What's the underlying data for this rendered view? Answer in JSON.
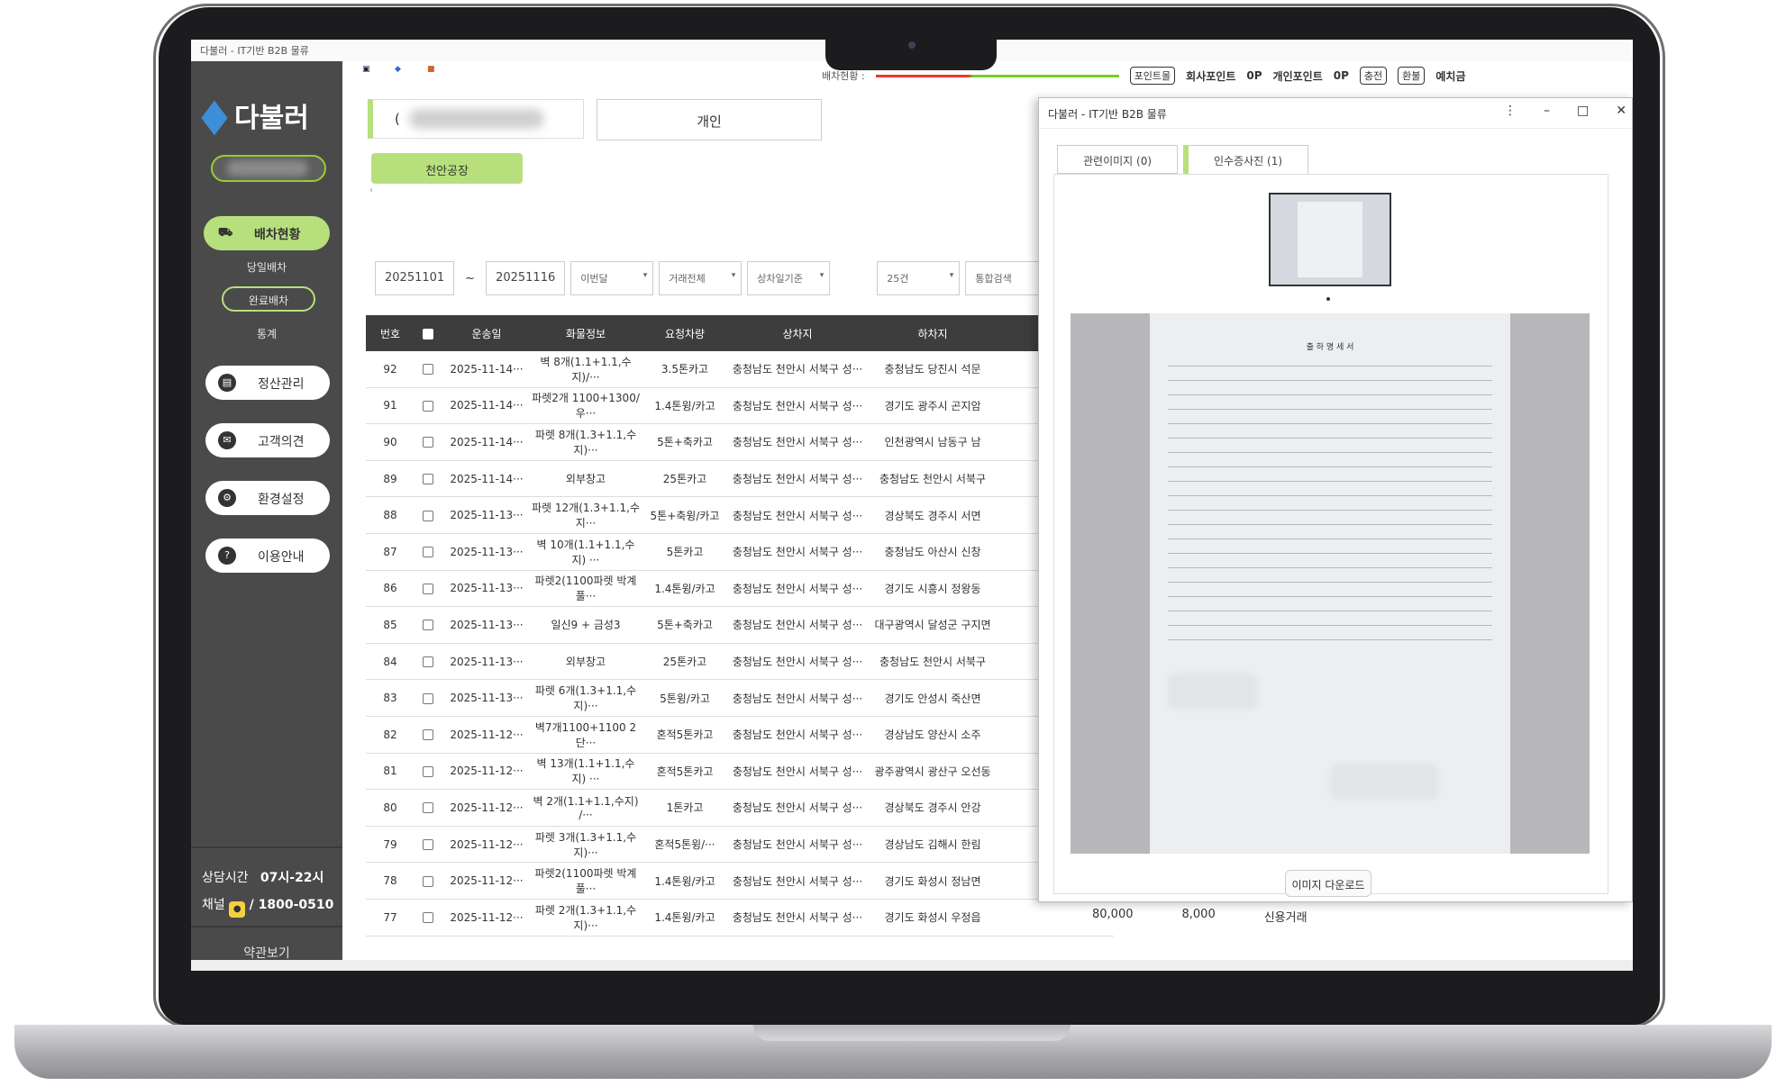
{
  "window_title": "다불러 - IT기반 B2B 물류",
  "sidebar": {
    "logo": "다불러",
    "nav_active": "배차현황",
    "sub_items": [
      "당일배차",
      "완료배차",
      "통계"
    ],
    "nav_items": [
      {
        "label": "정산관리",
        "icon": "document-icon"
      },
      {
        "label": "고객의견",
        "icon": "chat-icon"
      },
      {
        "label": "환경설정",
        "icon": "gear-icon"
      },
      {
        "label": "이용안내",
        "icon": "help-icon"
      }
    ],
    "hours_label": "상담시간",
    "hours_value": "07시-22시",
    "channel_label": "채널",
    "channel_phone": "/ 1800-0510",
    "terms": "약관보기"
  },
  "header": {
    "dispatch_label": "배차현황 :",
    "points_tag": "포인트몰",
    "company_points_label": "회사포인트",
    "company_points_value": "0P",
    "personal_points_label": "개인포인트",
    "personal_points_value": "0P",
    "charge": "충전",
    "refund": "환불",
    "deposit": "예치금"
  },
  "tabs": {
    "main_prefix": "(",
    "personal": "개인"
  },
  "factory_button": "천안공장",
  "filters": {
    "date_from": "20251101",
    "tilde": "~",
    "date_to": "20251116",
    "period": "이번달",
    "trade": "거래전체",
    "basis": "상차일기준",
    "page_size": "25건",
    "search": "통합검색"
  },
  "table": {
    "headers": [
      "번호",
      "운송일",
      "화물정보",
      "요청차량",
      "상차지",
      "하차지"
    ],
    "rows": [
      [
        "92",
        "2025-11-14···",
        "벽 8개(1.1+1.1,수지)/···",
        "3.5톤카고",
        "충청남도 천안시 서북구 성···",
        "충청남도 당진시 석문"
      ],
      [
        "91",
        "2025-11-14···",
        "파렛2개 1100+1300/우···",
        "1.4톤윙/카고",
        "충청남도 천안시 서북구 성···",
        "경기도 광주시 곤지암"
      ],
      [
        "90",
        "2025-11-14···",
        "파렛 8개(1.3+1.1,수지)···",
        "5톤+축카고",
        "충청남도 천안시 서북구 성···",
        "인천광역시 남동구 남"
      ],
      [
        "89",
        "2025-11-14···",
        "외부창고",
        "25톤카고",
        "충청남도 천안시 서북구 성···",
        "충청남도 천안시 서북구"
      ],
      [
        "88",
        "2025-11-13···",
        "파렛 12개(1.3+1.1,수지···",
        "5톤+축윙/카고",
        "충청남도 천안시 서북구 성···",
        "경상북도 경주시 서면"
      ],
      [
        "87",
        "2025-11-13···",
        "벽 10개(1.1+1.1,수지) ···",
        "5톤카고",
        "충청남도 천안시 서북구 성···",
        "충청남도 아산시 신창"
      ],
      [
        "86",
        "2025-11-13···",
        "파렛2(1100파렛 박계풀···",
        "1.4톤윙/카고",
        "충청남도 천안시 서북구 성···",
        "경기도 시흥시 정왕동"
      ],
      [
        "85",
        "2025-11-13···",
        "일신9 + 금성3",
        "5톤+축카고",
        "충청남도 천안시 서북구 성···",
        "대구광역시 달성군 구지면"
      ],
      [
        "84",
        "2025-11-13···",
        "외부창고",
        "25톤카고",
        "충청남도 천안시 서북구 성···",
        "충청남도 천안시 서북구"
      ],
      [
        "83",
        "2025-11-13···",
        "파렛 6개(1.3+1.1,수지)···",
        "5톤윙/카고",
        "충청남도 천안시 서북구 성···",
        "경기도 안성시 죽산면"
      ],
      [
        "82",
        "2025-11-12···",
        "벽7개1100+1100 2단···",
        "혼적5톤카고",
        "충청남도 천안시 서북구 성···",
        "경상남도 양산시 소주"
      ],
      [
        "81",
        "2025-11-12···",
        "벽 13개(1.1+1.1,수지) ···",
        "혼적5톤카고",
        "충청남도 천안시 서북구 성···",
        "광주광역시 광산구 오선동"
      ],
      [
        "80",
        "2025-11-12···",
        "벽 2개(1.1+1.1,수지) /···",
        "1톤카고",
        "충청남도 천안시 서북구 성···",
        "경상북도 경주시 안강"
      ],
      [
        "79",
        "2025-11-12···",
        "파렛 3개(1.3+1.1,수지)···",
        "혼적5톤윙/···",
        "충청남도 천안시 서북구 성···",
        "경상남도 김해시 한림"
      ],
      [
        "78",
        "2025-11-12···",
        "파렛2(1100파렛 박계풀···",
        "1.4톤윙/카고",
        "충청남도 천안시 서북구 성···",
        "경기도 화성시 정남면"
      ],
      [
        "77",
        "2025-11-12···",
        "파렛 2개(1.3+1.1,수지)···",
        "1.4톤윙/카고",
        "충청남도 천안시 서북구 성···",
        "경기도 화성시 우정읍"
      ]
    ]
  },
  "popup": {
    "title": "다불러 - IT기반 B2B 물류",
    "tab_related": "관련이미지 (0)",
    "tab_receipt": "인수증사진 (1)",
    "doc_title": "출 하 명 세 서",
    "download": "이미지 다운로드"
  },
  "under_popup": {
    "amount": "80,000",
    "fee": "8,000",
    "credit": "신용거래"
  }
}
